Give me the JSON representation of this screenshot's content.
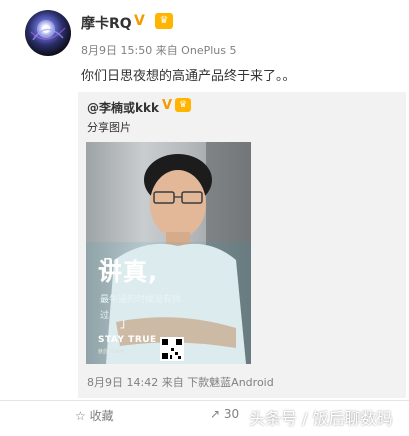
{
  "post": {
    "username": "摩卡RQ",
    "verified_mark": "V",
    "level_badge": "♛",
    "meta": "8月9日 15:50 来自 OnePlus 5",
    "text": "你们日思夜想的高通产品终于来了。。"
  },
  "repost": {
    "username": "@李楠或kkk",
    "verified_mark": "V",
    "level_badge": "♛",
    "text": "分享图片",
    "image": {
      "headline": "讲真,",
      "subtext_line1": "最牛逼的时候没有帅",
      "subtext_line2": "过",
      "tagline": "STAY TRUE",
      "brand": "魅蓝 Note6"
    },
    "meta": "8月9日 14:42 来自 下款魅蓝Android"
  },
  "actions": {
    "favorite_label": "收藏",
    "share_count": "30"
  },
  "watermark": "头条号 / 饭后聊数码",
  "colors": {
    "verified": "#f39a00",
    "badge": "#ffb400",
    "meta_gray": "#808080"
  }
}
